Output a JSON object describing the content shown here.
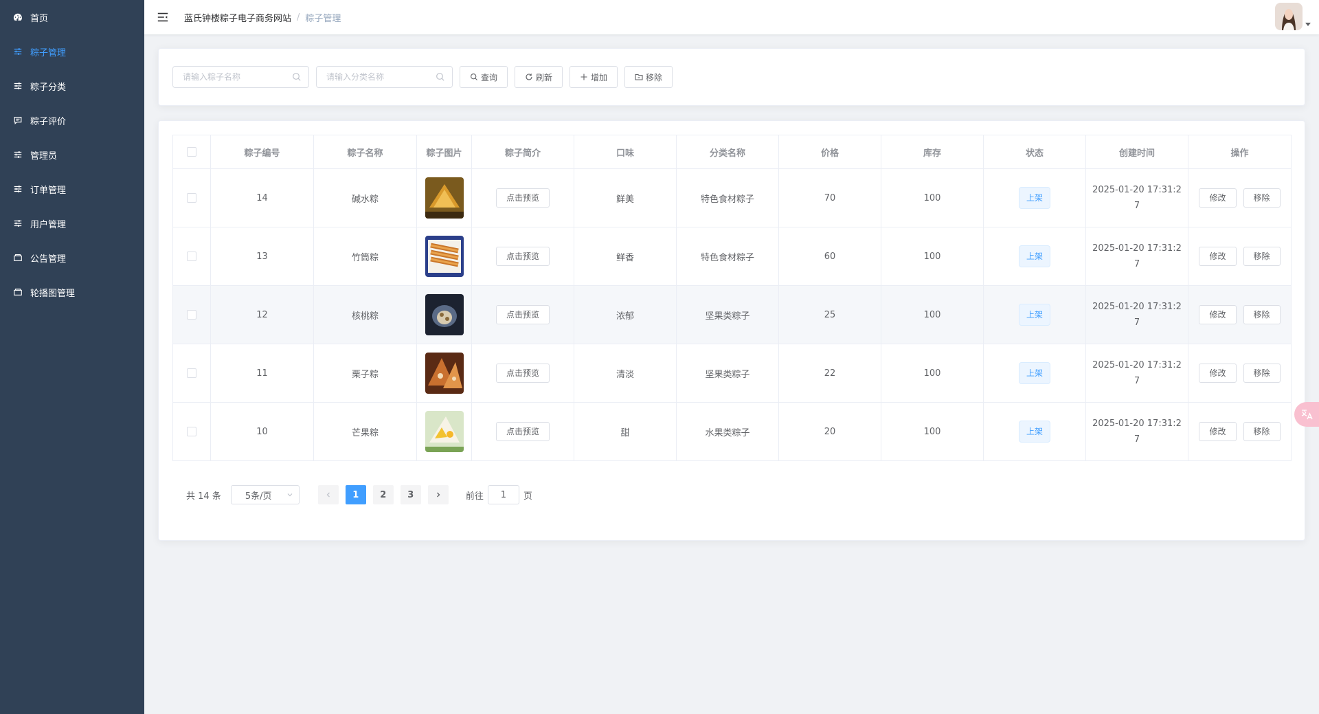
{
  "sidebar": {
    "items": [
      {
        "label": "首页",
        "icon": "dashboard-icon",
        "active": false
      },
      {
        "label": "粽子管理",
        "icon": "sliders-icon",
        "active": true
      },
      {
        "label": "粽子分类",
        "icon": "sliders-icon",
        "active": false
      },
      {
        "label": "粽子评价",
        "icon": "comment-icon",
        "active": false
      },
      {
        "label": "管理员",
        "icon": "sliders-icon",
        "active": false
      },
      {
        "label": "订单管理",
        "icon": "sliders-icon",
        "active": false
      },
      {
        "label": "用户管理",
        "icon": "sliders-icon",
        "active": false
      },
      {
        "label": "公告管理",
        "icon": "box-icon",
        "active": false
      },
      {
        "label": "轮播图管理",
        "icon": "box-icon",
        "active": false
      }
    ]
  },
  "header": {
    "breadcrumb_home": "蓝氏钟楼粽子电子商务网站",
    "breadcrumb_sep": "/",
    "breadcrumb_current": "粽子管理"
  },
  "search": {
    "name_placeholder": "请输入粽子名称",
    "category_placeholder": "请输入分类名称",
    "query_label": "查询",
    "refresh_label": "刷新",
    "add_label": "增加",
    "remove_label": "移除"
  },
  "table": {
    "headers": [
      "粽子编号",
      "粽子名称",
      "粽子图片",
      "粽子简介",
      "口味",
      "分类名称",
      "价格",
      "库存",
      "状态",
      "创建时间",
      "操作"
    ],
    "rows": [
      {
        "id": "14",
        "name": "碱水粽",
        "preview": "点击预览",
        "taste": "鲜美",
        "category": "特色食材粽子",
        "price": "70",
        "stock": "100",
        "status": "上架",
        "created": "2025-01-20 17:31:27",
        "edit": "修改",
        "delete": "移除"
      },
      {
        "id": "13",
        "name": "竹筒粽",
        "preview": "点击预览",
        "taste": "鲜香",
        "category": "特色食材粽子",
        "price": "60",
        "stock": "100",
        "status": "上架",
        "created": "2025-01-20 17:31:27",
        "edit": "修改",
        "delete": "移除"
      },
      {
        "id": "12",
        "name": "核桃粽",
        "preview": "点击预览",
        "taste": "浓郁",
        "category": "坚果类粽子",
        "price": "25",
        "stock": "100",
        "status": "上架",
        "created": "2025-01-20 17:31:27",
        "edit": "修改",
        "delete": "移除"
      },
      {
        "id": "11",
        "name": "栗子粽",
        "preview": "点击预览",
        "taste": "清淡",
        "category": "坚果类粽子",
        "price": "22",
        "stock": "100",
        "status": "上架",
        "created": "2025-01-20 17:31:27",
        "edit": "修改",
        "delete": "移除"
      },
      {
        "id": "10",
        "name": "芒果粽",
        "preview": "点击预览",
        "taste": "甜",
        "category": "水果类粽子",
        "price": "20",
        "stock": "100",
        "status": "上架",
        "created": "2025-01-20 17:31:27",
        "edit": "修改",
        "delete": "移除"
      }
    ]
  },
  "pagination": {
    "total": "共 14 条",
    "page_size": "5条/页",
    "pages": [
      "1",
      "2",
      "3"
    ],
    "current": "1",
    "goto_label": "前往",
    "goto_value": "1",
    "page_unit": "页"
  },
  "colors": {
    "sidebar_bg": "#304156",
    "accent": "#409eff"
  }
}
